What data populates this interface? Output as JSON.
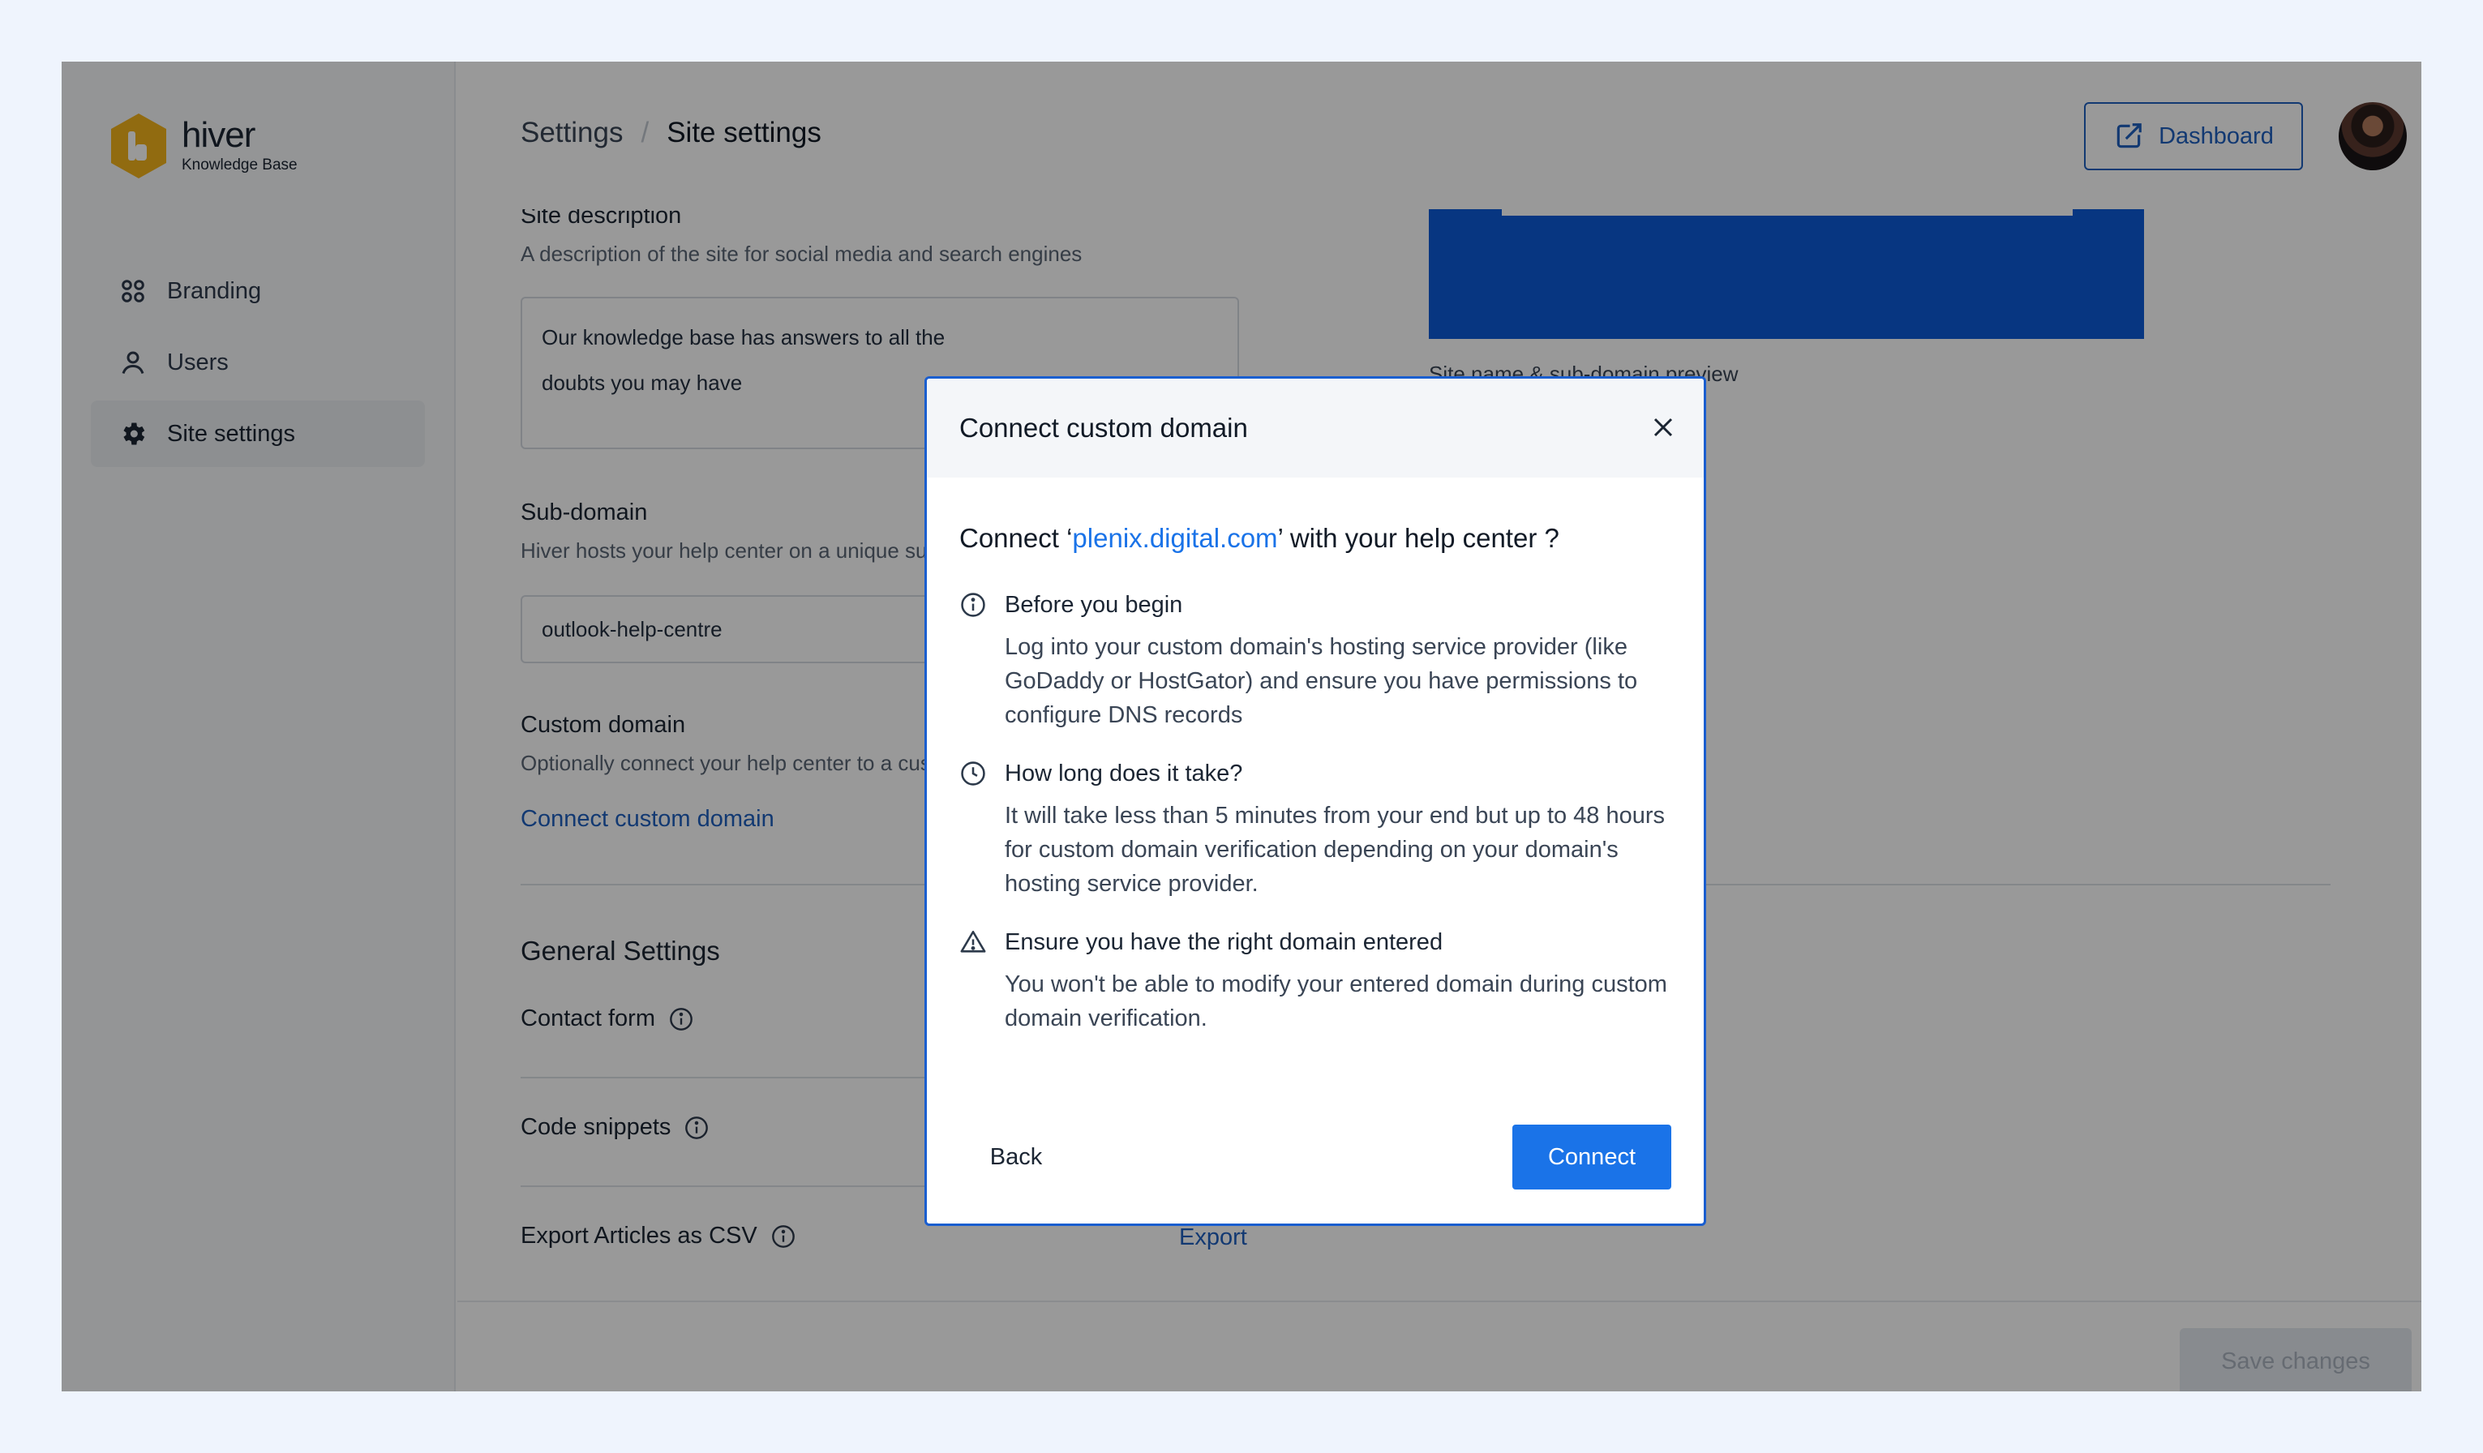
{
  "app": {
    "logo_name": "hiver",
    "logo_sub": "Knowledge Base"
  },
  "sidebar": {
    "items": [
      {
        "label": "Branding",
        "icon": "grid-icon"
      },
      {
        "label": "Users",
        "icon": "user-icon"
      },
      {
        "label": "Site settings",
        "icon": "gear-icon",
        "active": true
      }
    ]
  },
  "header": {
    "breadcrumb": [
      "Settings",
      "Site settings"
    ],
    "breadcrumb_sep": "/",
    "dashboard_label": "Dashboard"
  },
  "form": {
    "site_description": {
      "label": "Site description",
      "desc": "A description of the site for social media and search engines",
      "value_line1": "Our knowledge base has answers to all the",
      "value_line2": "doubts you may have"
    },
    "subdomain": {
      "label": "Sub-domain",
      "desc": "Hiver hosts your help center on a unique sub-domain",
      "value": "outlook-help-centre"
    },
    "custom_domain": {
      "label": "Custom domain",
      "desc": "Optionally connect your help center to a custom domain",
      "link": "Connect custom domain"
    },
    "preview_label": "Site name & sub-domain preview",
    "general": {
      "title": "General Settings",
      "contact_form": "Contact form",
      "code_snippets": "Code snippets",
      "export_csv": "Export Articles as CSV",
      "export_link": "Export"
    },
    "save_label": "Save changes"
  },
  "modal": {
    "title": "Connect custom domain",
    "question_prefix": "Connect ‘",
    "domain": "plenix.digital.com",
    "question_suffix": "’ with your help center ?",
    "steps": [
      {
        "icon": "info-icon",
        "title": "Before you begin",
        "body": "Log into your custom domain's hosting service provider (like GoDaddy or HostGator) and ensure you have permissions to configure DNS records"
      },
      {
        "icon": "clock-icon",
        "title": "How long does it take?",
        "body": "It will take less than 5 minutes from your end but up to 48 hours for custom domain verification depending on your domain's hosting service provider."
      },
      {
        "icon": "warning-icon",
        "title": "Ensure you have the right domain entered",
        "body": "You won't be able to modify your entered domain during custom domain verification."
      }
    ],
    "back_label": "Back",
    "connect_label": "Connect"
  },
  "colors": {
    "accent": "#1a73e8",
    "link": "#1f5fbf",
    "logo": "#f2b21b"
  }
}
